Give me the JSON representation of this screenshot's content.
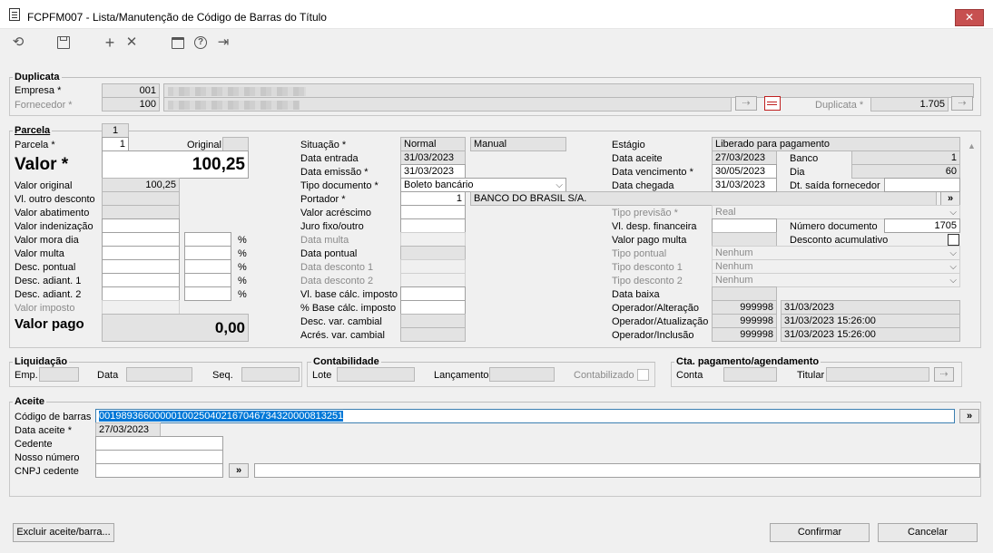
{
  "window": {
    "title": "FCPFM007 - Lista/Manutenção de Código de Barras do Título",
    "close_label": "✕"
  },
  "icons": [
    "refresh-icon",
    "save-icon",
    "add-icon",
    "delete-icon",
    "calendar-icon",
    "help-icon",
    "exit-icon"
  ],
  "duplicata": {
    "title": "Duplicata",
    "empresa_label": "Empresa *",
    "empresa_value": "001",
    "fornecedor_label": "Fornecedor *",
    "fornecedor_value": "100",
    "duplicata_label": "Duplicata *",
    "duplicata_value": "1.705"
  },
  "parcela": {
    "title": "Parcela",
    "tab_value": "1",
    "parcela_label": "Parcela *",
    "parcela_value": "1",
    "original_label": "Original",
    "valor_label": "Valor *",
    "valor_value": "100,25",
    "valor_original_label": "Valor original",
    "valor_original_value": "100,25",
    "outro_desconto_label": "Vl. outro desconto",
    "abatimento_label": "Valor abatimento",
    "indenizacao_label": "Valor indenização",
    "mora_dia_label": "Valor mora dia",
    "multa_label": "Valor multa",
    "desc_pontual_label": "Desc. pontual",
    "desc_adiant1_label": "Desc. adiant. 1",
    "desc_adiant2_label": "Desc. adiant. 2",
    "valor_imposto_label": "Valor imposto",
    "percent": "%",
    "valor_pago_label": "Valor pago",
    "valor_pago_value": "0,00",
    "situacao_label": "Situação *",
    "situacao_value": "Normal",
    "situacao_value2": "Manual",
    "data_entrada_label": "Data entrada",
    "data_entrada_value": "31/03/2023",
    "data_emissao_label": "Data emissão *",
    "data_emissao_value": "31/03/2023",
    "tipo_documento_label": "Tipo documento *",
    "tipo_documento_value": "Boleto bancário",
    "portador_label": "Portador *",
    "portador_value": "1",
    "portador_name": "BANCO DO BRASIL S/A.",
    "valor_acrescimo_label": "Valor acréscimo",
    "juro_label": "Juro fixo/outro",
    "data_multa_label": "Data multa",
    "data_pontual_label": "Data pontual",
    "data_desconto1_label": "Data desconto 1",
    "data_desconto2_label": "Data desconto 2",
    "base_calc_label": "Vl. base cálc. imposto",
    "pct_base_label": "% Base cálc. imposto",
    "desc_var_label": "Desc. var. cambial",
    "acres_var_label": "Acrés. var. cambial",
    "estagio_label": "Estágio",
    "estagio_value": "Liberado para pagamento",
    "data_aceite_label": "Data aceite",
    "data_aceite_value": "27/03/2023",
    "banco_label": "Banco",
    "banco_value": "1",
    "data_vencimento_label": "Data vencimento *",
    "data_vencimento_value": "30/05/2023",
    "dia_label": "Dia",
    "dia_value": "60",
    "data_chegada_label": "Data chegada",
    "data_chegada_value": "31/03/2023",
    "dt_saida_label": "Dt. saída fornecedor",
    "tipo_previsao_label": "Tipo previsão *",
    "tipo_previsao_value": "Real",
    "desp_financeira_label": "Vl. desp. financeira",
    "numero_documento_label": "Número documento",
    "numero_documento_value": "1705",
    "valor_pago_multa_label": "Valor pago multa",
    "desconto_acumulativo_label": "Desconto acumulativo",
    "tipo_pontual_label": "Tipo pontual",
    "tipo_pontual_value": "Nenhum",
    "tipo_desconto1_label": "Tipo desconto 1",
    "tipo_desconto1_value": "Nenhum",
    "tipo_desconto2_label": "Tipo desconto 2",
    "tipo_desconto2_value": "Nenhum",
    "data_baixa_label": "Data baixa",
    "op_alteracao_label": "Operador/Alteração",
    "op_alteracao_id": "999998",
    "op_alteracao_date": "31/03/2023",
    "op_atualizacao_label": "Operador/Atualização",
    "op_atualizacao_id": "999998",
    "op_atualizacao_date": "31/03/2023 15:26:00",
    "op_inclusao_label": "Operador/Inclusão",
    "op_inclusao_id": "999998",
    "op_inclusao_date": "31/03/2023 15:26:00"
  },
  "liquidacao": {
    "title": "Liquidação",
    "emp_label": "Emp.",
    "data_label": "Data",
    "seq_label": "Seq."
  },
  "contabilidade": {
    "title": "Contabilidade",
    "lote_label": "Lote",
    "lancamento_label": "Lançamento",
    "contabilizado_label": "Contabilizado"
  },
  "cta": {
    "title": "Cta. pagamento/agendamento",
    "conta_label": "Conta",
    "titular_label": "Titular"
  },
  "aceite": {
    "title": "Aceite",
    "codigo_label": "Código de barras",
    "codigo_value": "00198936600000100250402167046734320000813251",
    "data_aceite_label": "Data aceite *",
    "data_aceite_value": "27/03/2023",
    "cedente_label": "Cedente",
    "nosso_numero_label": "Nosso número",
    "cnpj_label": "CNPJ cedente"
  },
  "buttons": {
    "excluir": "Excluir aceite/barra...",
    "confirmar": "Confirmar",
    "cancelar": "Cancelar",
    "more": "»",
    "dots": "..."
  }
}
